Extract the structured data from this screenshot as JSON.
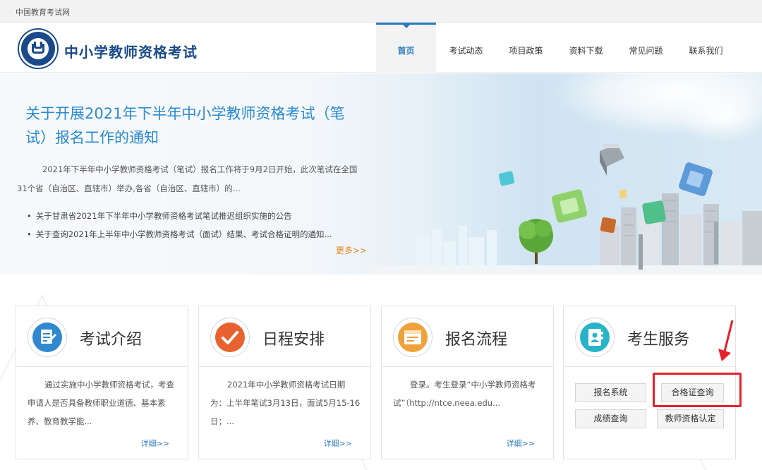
{
  "topbar": {
    "site_name": "中国教育考试网"
  },
  "header": {
    "title": "中小学教师资格考试",
    "nav": [
      "首页",
      "考试动态",
      "项目政策",
      "资料下载",
      "常见问题",
      "联系我们"
    ]
  },
  "banner": {
    "title": "关于开展2021年下半年中小学教师资格考试（笔试）报名工作的通知",
    "summary": "2021年下半年中小学教师资格考试（笔试）报名工作将于9月2日开始，此次笔试在全国31个省（自治区、直辖市）举办,各省（自治区、直辖市）的...",
    "list": [
      "关于甘肃省2021年下半年中小学教师资格考试笔试推迟组织实施的公告",
      "关于查询2021年上半年中小学教师资格考试（面试）结果、考试合格证明的通知..."
    ],
    "more": "更多>>"
  },
  "cards": [
    {
      "title": "考试介绍",
      "icon": "document-edit-icon",
      "desc": "通过实施中小学教师资格考试，考查申请人是否具备教师职业道德、基本素养、教育教学能...",
      "detail": "详细>>"
    },
    {
      "title": "日程安排",
      "icon": "checkmark-icon",
      "desc": "2021年中小学教师资格考试日期为：上半年笔试3月13日，面试5月15-16日；...",
      "detail": "详细>>"
    },
    {
      "title": "报名流程",
      "icon": "browser-window-icon",
      "desc": "登录。考生登录“中小学教师资格考试”（http://ntce.neea.edu...",
      "detail": "详细>>"
    },
    {
      "title": "考生服务",
      "icon": "address-book-icon"
    }
  ],
  "services": {
    "buttons": [
      "报名系统",
      "合格证查询",
      "成绩查询",
      "教师资格认定"
    ]
  },
  "colors": {
    "accent": "#2a7bc0",
    "title_blue": "#2a8ad2",
    "more_orange": "#e8891b",
    "highlight_red": "#e6212a"
  }
}
